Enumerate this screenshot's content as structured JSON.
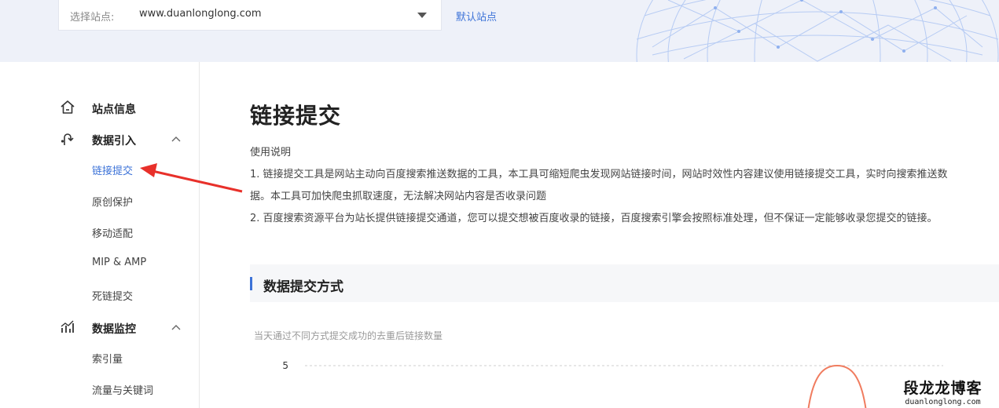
{
  "top_bar": {
    "select_label": "选择站点:",
    "site_value": "www.duanlonglong.com",
    "default_site_link": "默认站点"
  },
  "sidebar": {
    "groups": [
      {
        "title": "站点信息",
        "icon": "home-icon",
        "items": []
      },
      {
        "title": "数据引入",
        "icon": "data-import-icon",
        "expanded": true,
        "items": [
          {
            "label": "链接提交",
            "active": true
          },
          {
            "label": "原创保护"
          },
          {
            "label": "移动适配"
          },
          {
            "label": "MIP & AMP"
          },
          {
            "label": "死链提交"
          }
        ]
      },
      {
        "title": "数据监控",
        "icon": "chart-bars-icon",
        "expanded": true,
        "items": [
          {
            "label": "索引量"
          },
          {
            "label": "流量与关键词"
          }
        ]
      }
    ]
  },
  "main": {
    "title": "链接提交",
    "usage_label": "使用说明",
    "usage_lines": [
      "1. 链接提交工具是网站主动向百度搜索推送数据的工具，本工具可缩短爬虫发现网站链接时间，网站时效性内容建议使用链接提交工具，实时向搜索推送数",
      "据。本工具可加快爬虫抓取速度，无法解决网站内容是否收录问题",
      "2. 百度搜索资源平台为站长提供链接提交通道，您可以提交想被百度收录的链接，百度搜索引擎会按照标准处理，但不保证一定能够收录您提交的链接。"
    ],
    "section_title": "数据提交方式",
    "chart_description": "当天通过不同方式提交成功的去重后链接数量"
  },
  "chart_data": {
    "type": "line",
    "y_tick_labels": [
      "5"
    ],
    "ylim": [
      0,
      5
    ],
    "grid": true,
    "series": [
      {
        "color": "#f07c5f",
        "peak_value": 5
      }
    ]
  },
  "watermark": {
    "cn": "段龙龙博客",
    "en": "duanlonglong.com"
  },
  "colors": {
    "accent": "#3d73d8",
    "banner_bg": "#eef1f9",
    "chart_line": "#f07c5f"
  }
}
